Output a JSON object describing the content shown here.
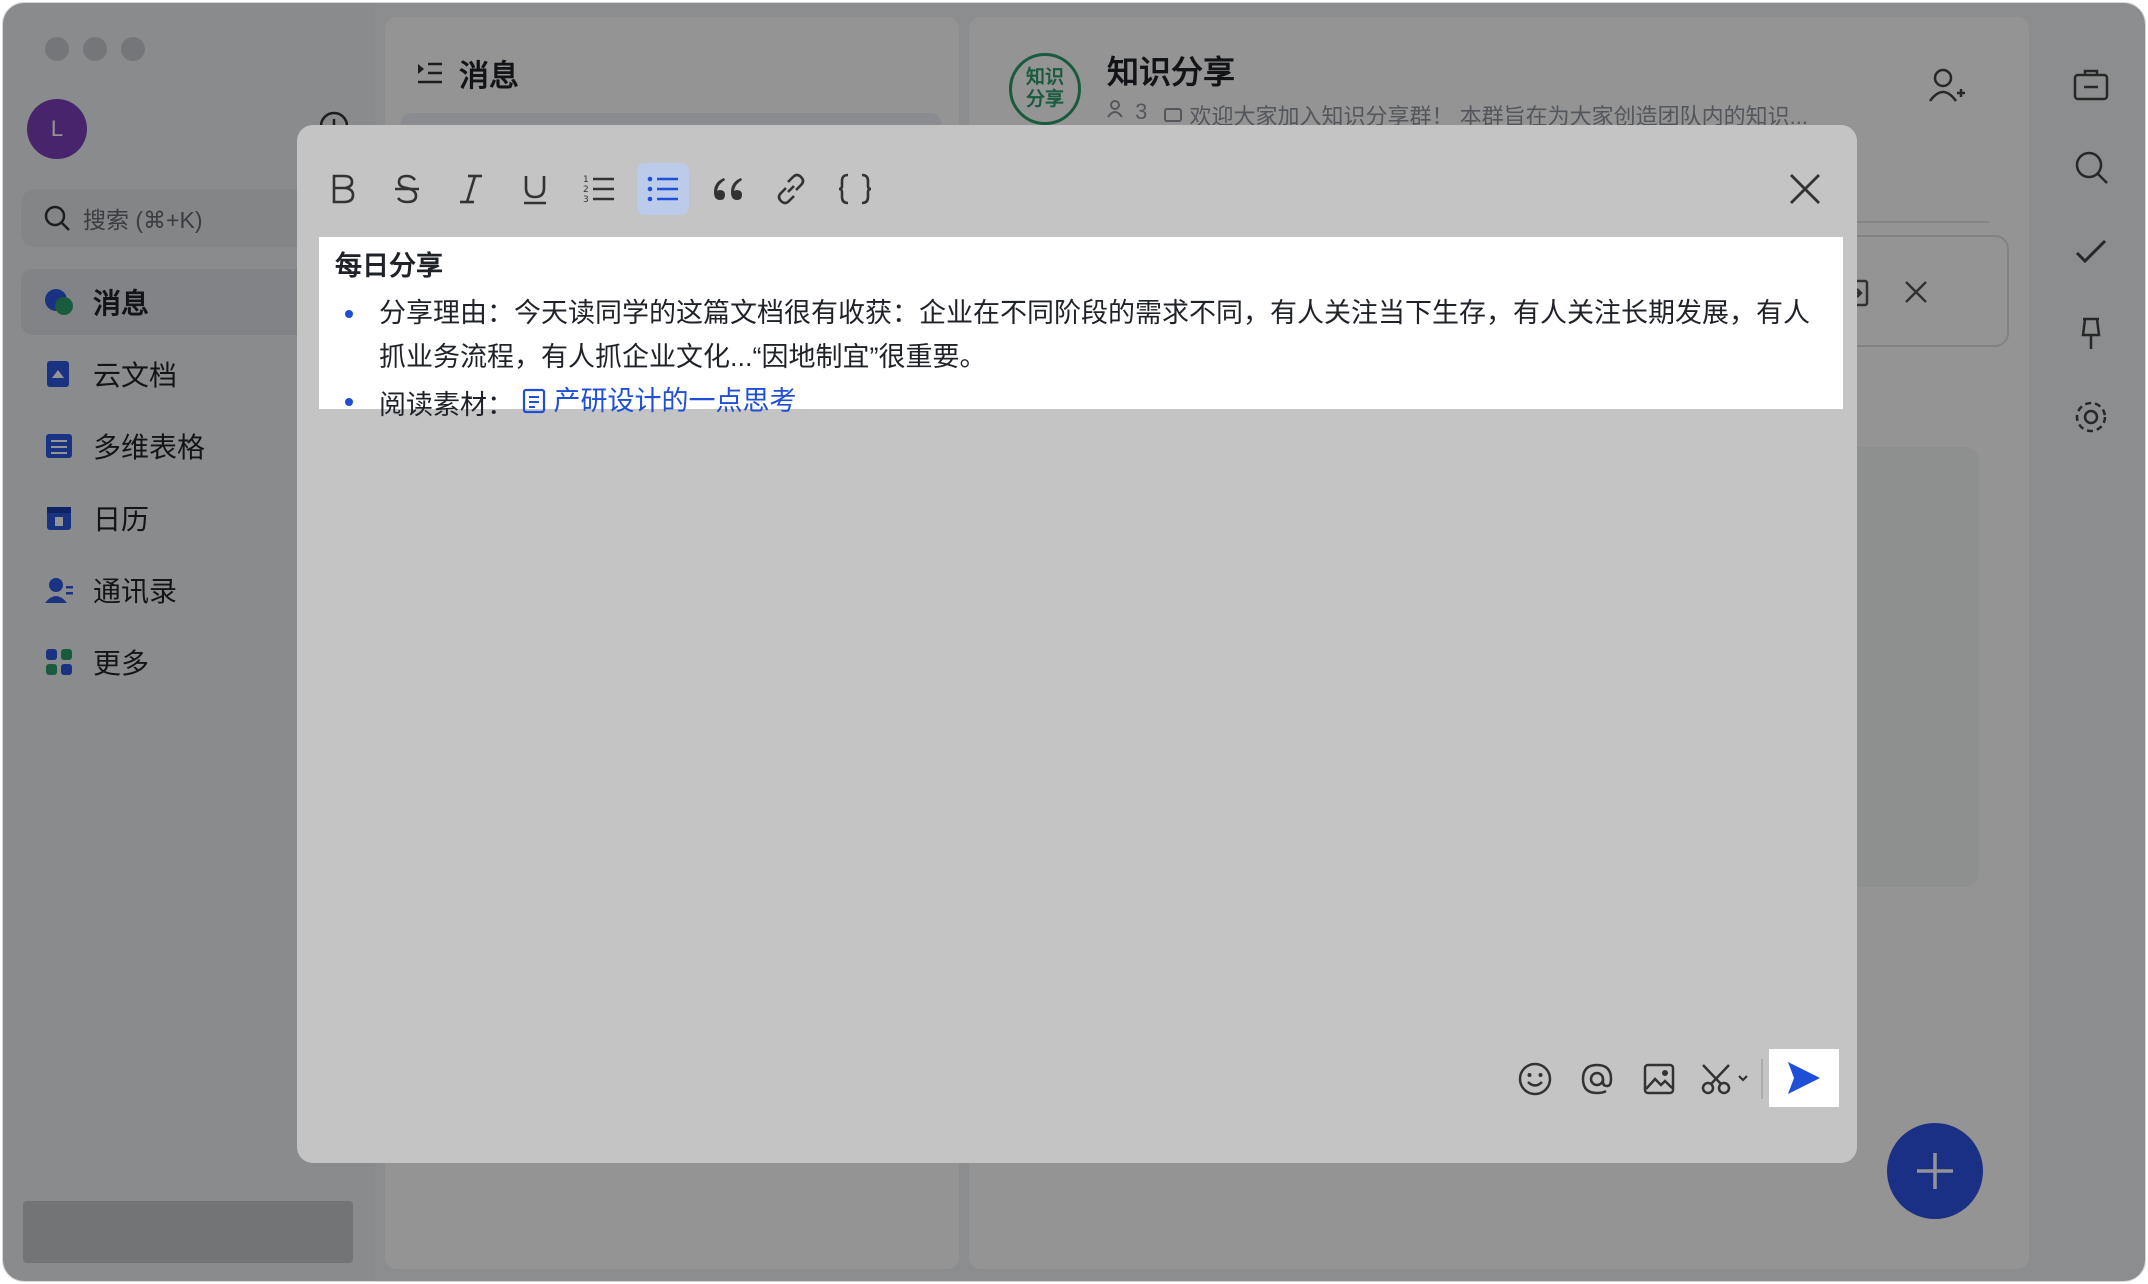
{
  "sidebar": {
    "avatar_initial": "L",
    "search_placeholder": "搜索 (⌘+K)",
    "items": [
      {
        "label": "消息",
        "icon": "chat-bubble-icon",
        "active": true
      },
      {
        "label": "云文档",
        "icon": "cloud-doc-icon"
      },
      {
        "label": "多维表格",
        "icon": "base-table-icon"
      },
      {
        "label": "日历",
        "icon": "calendar-icon"
      },
      {
        "label": "通讯录",
        "icon": "contacts-icon"
      },
      {
        "label": "更多",
        "icon": "more-apps-icon"
      }
    ]
  },
  "conversation_list": {
    "title": "消息"
  },
  "chat": {
    "group_avatar_text": "知识\n分享",
    "group_name": "知识分享",
    "member_count": "3",
    "announcement": "欢迎大家加入知识分享群！ 本群旨在为大家创造团队内的知识..."
  },
  "modal": {
    "toolbar": [
      {
        "name": "bold",
        "label": "B"
      },
      {
        "name": "strikethrough",
        "label": "S"
      },
      {
        "name": "italic",
        "label": "I"
      },
      {
        "name": "underline",
        "label": "U"
      },
      {
        "name": "ordered-list"
      },
      {
        "name": "bullet-list",
        "active": true
      },
      {
        "name": "quote"
      },
      {
        "name": "link"
      },
      {
        "name": "code-block",
        "label": "{ }"
      }
    ],
    "content": {
      "heading": "每日分享",
      "bullet1": "分享理由：今天读同学的这篇文档很有收获：企业在不同阶段的需求不同，有人关注当下生存，有人关注长期发展，有人抓业务流程，有人抓企业文化...“因地制宜”很重要。",
      "bullet2_prefix": "阅读素材：",
      "bullet2_link": "产研设计的一点思考"
    }
  },
  "colors": {
    "accent": "#1e4fd6",
    "fab": "#2c54e6",
    "avatar": "#7a3fb8",
    "group_green": "#2e9e6b"
  }
}
